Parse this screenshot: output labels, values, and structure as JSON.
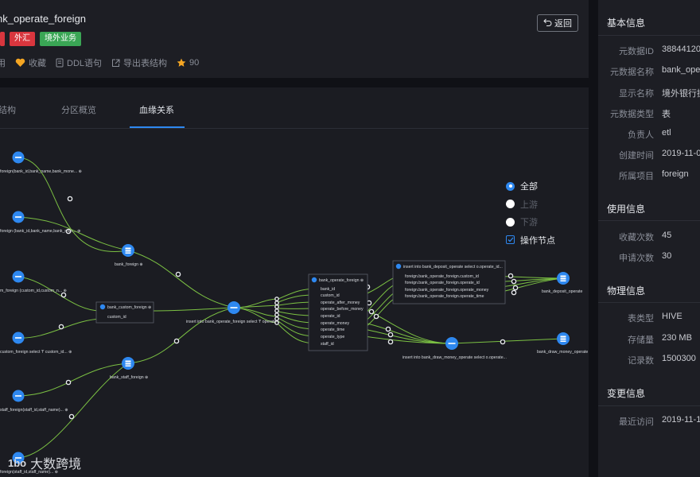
{
  "header": {
    "title": "nk_operate_foreign",
    "tags": [
      "外汇",
      "境外业务"
    ],
    "meta": [
      {
        "icon": "apply-icon",
        "label": "用"
      },
      {
        "icon": "heart-icon",
        "label": "收藏"
      },
      {
        "icon": "ddl-icon",
        "label": "DDL语句"
      },
      {
        "icon": "export-icon",
        "label": "导出表结构"
      },
      {
        "icon": "star-icon",
        "label": "90"
      }
    ],
    "back_label": "返回"
  },
  "tabs": [
    {
      "label": "结构",
      "active": false
    },
    {
      "label": "分区概览",
      "active": false
    },
    {
      "label": "血缘关系",
      "active": true
    }
  ],
  "filters": {
    "options": [
      {
        "label": "全部",
        "checked": true
      },
      {
        "label": "上游",
        "checked": false
      },
      {
        "label": "下游",
        "checked": false
      }
    ],
    "show_op_nodes": {
      "label": "操作节点",
      "checked": true
    }
  },
  "lineage": {
    "left_sources": [
      "foreign(bank_id,bank_name,bank_mone... ⊕",
      "foreign (bank_id,bank_name,bank_mon... ⊕",
      "m_foreign (custom_id,custom_n... ⊕",
      "custom_foreign select 'f' custom_id... ⊕",
      "staff_foreign(staff_id,staff_name)... ⊕",
      "foreign(staff_id,staff_name)... ⊕"
    ],
    "bank_foreign": "bank_foreign ⊕",
    "bank_staff_foreign": "bank_staff_foreign ⊕",
    "custom_box": {
      "title": "bank_custom_foreign ⊕",
      "field": "custom_id"
    },
    "center_op": "insert into bank_operate_foreign select 'f' operate...",
    "center_table": {
      "title": "bank_operate_foreign ⊕",
      "fields": [
        "bank_id",
        "custom_id",
        "operate_after_money",
        "operate_before_money",
        "operate_id",
        "operate_money",
        "operate_time",
        "operate_type",
        "staff_id"
      ]
    },
    "right_op_box": {
      "title": "insert into bank_deposit_operate select o.operate_id...",
      "fields": [
        "foreign.bank_operate_foreign.custom_id",
        "foreign.bank_operate_foreign.operate_id",
        "foreign.bank_operate_foreign.operate_money",
        "foreign.bank_operate_foreign.operate_time"
      ]
    },
    "lower_op": "insert into bank_draw_money_operate select o.operate...",
    "targets": [
      "bank_deposit_operate",
      "bank_draw_money_operate"
    ]
  },
  "watermark": {
    "logo": "1bo",
    "text": "大数跨境"
  },
  "side": {
    "basic": {
      "title": "基本信息",
      "rows": [
        {
          "k": "元数据ID",
          "v": "38844120"
        },
        {
          "k": "元数据名称",
          "v": "bank_ope"
        },
        {
          "k": "显示名称",
          "v": "境外银行操"
        },
        {
          "k": "元数据类型",
          "v": "表"
        },
        {
          "k": "负责人",
          "v": "etl"
        },
        {
          "k": "创建时间",
          "v": "2019-11-0"
        },
        {
          "k": "所属项目",
          "v": "foreign"
        }
      ]
    },
    "usage": {
      "title": "使用信息",
      "rows": [
        {
          "k": "收藏次数",
          "v": "45"
        },
        {
          "k": "申请次数",
          "v": "30"
        }
      ]
    },
    "physical": {
      "title": "物理信息",
      "rows": [
        {
          "k": "表类型",
          "v": "HIVE"
        },
        {
          "k": "存储量",
          "v": "230 MB"
        },
        {
          "k": "记录数",
          "v": "1500300"
        }
      ]
    },
    "change": {
      "title": "变更信息",
      "rows": [
        {
          "k": "最近访问",
          "v": "2019-11-1"
        }
      ]
    }
  },
  "colors": {
    "accent": "#2e88f0",
    "edge": "#7bc043",
    "tag_red": "#d9363e",
    "tag_green": "#3aa655"
  }
}
